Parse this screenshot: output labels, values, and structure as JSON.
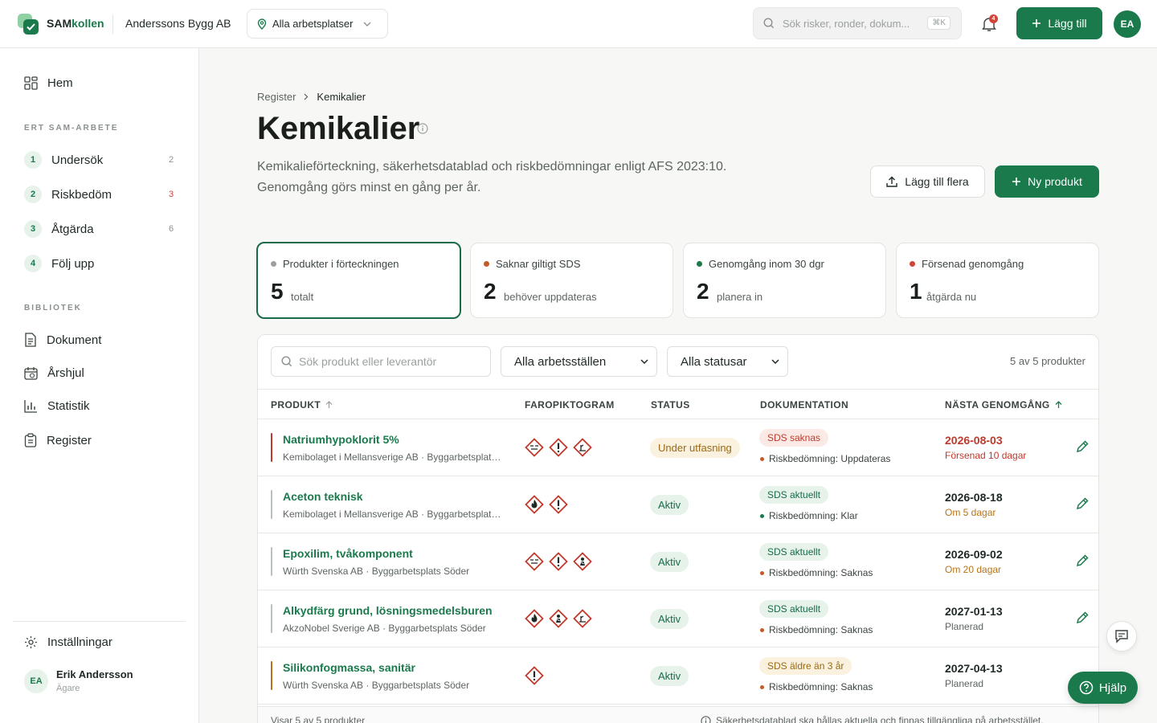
{
  "app": {
    "brand_a": "SAM",
    "brand_b": "kollen",
    "company": "Anderssons Bygg AB",
    "site_select": "Alla arbetsplatser",
    "search_placeholder": "Sök risker, ronder, dokum...",
    "search_shortcut": "⌘K",
    "notifications": "4",
    "add_label": "Lägg till",
    "user_initials": "EA"
  },
  "sidebar": {
    "home": "Hem",
    "section_sam": "ERT SAM-ARBETE",
    "steps": [
      {
        "num": "1",
        "label": "Undersök",
        "count": "2"
      },
      {
        "num": "2",
        "label": "Riskbedöm",
        "count": "3"
      },
      {
        "num": "3",
        "label": "Åtgärda",
        "count": "6"
      },
      {
        "num": "4",
        "label": "Följ upp",
        "count": ""
      }
    ],
    "section_lib": "BIBLIOTEK",
    "library": [
      {
        "label": "Dokument",
        "icon": "document-icon"
      },
      {
        "label": "Årshjul",
        "icon": "calendar-icon"
      },
      {
        "label": "Statistik",
        "icon": "bar-chart-icon"
      },
      {
        "label": "Register",
        "icon": "clipboard-icon"
      }
    ],
    "settings": "Inställningar",
    "user_name": "Erik Andersson",
    "user_role": "Ägare",
    "user_initials": "EA"
  },
  "page": {
    "crumb_parent": "Register",
    "crumb_current": "Kemikalier",
    "title": "Kemikalier",
    "desc1": "Kemikalieförteckning, säkerhetsdatablad och riskbedömningar enligt AFS 2023:10.",
    "desc2": "Genomgång görs minst en gång per år.",
    "btn_bulk": "Lägg till flera",
    "btn_new": "Ny produkt"
  },
  "stats": [
    {
      "label": "Produkter i förteckningen",
      "num": "5",
      "sub": "totalt",
      "color": "#9aa19c"
    },
    {
      "label": "Saknar giltigt SDS",
      "num": "2",
      "sub": "behöver uppdateras",
      "color": "#c25a2a"
    },
    {
      "label": "Genomgång inom 30 dgr",
      "num": "2",
      "sub": "planera in",
      "color": "#1a7a4c"
    },
    {
      "label": "Försenad genomgång",
      "num": "1",
      "sub": "åtgärda nu",
      "color": "#d0443a"
    }
  ],
  "filters": {
    "search_placeholder": "Sök produkt eller leverantör",
    "site": "Alla arbetsställen",
    "status": "Alla statusar",
    "count": "5 av 5 produkter"
  },
  "table": {
    "headers": {
      "product": "PRODUKT",
      "pictograms": "FAROPIKTOGRAM",
      "status": "STATUS",
      "docs": "DOKUMENTATION",
      "next": "NÄSTA GENOMGÅNG"
    },
    "rows": [
      {
        "name": "Natriumhypoklorit 5%",
        "sub": "Kemibolaget i Mellansverige AB · Byggarbetsplats Söder",
        "status": "Under utfasning",
        "sds": "SDS saknas",
        "risk": "Riskbedömning: Uppdateras",
        "date": "2026-08-03",
        "when": "Försenad 10 dagar"
      },
      {
        "name": "Aceton teknisk",
        "sub": "Kemibolaget i Mellansverige AB · Byggarbetsplats Söder",
        "status": "Aktiv",
        "sds": "SDS aktuellt",
        "risk": "Riskbedömning: Klar",
        "date": "2026-08-18",
        "when": "Om 5 dagar"
      },
      {
        "name": "Epoxilim, tvåkomponent",
        "sub": "Würth Svenska AB · Byggarbetsplats Söder",
        "status": "Aktiv",
        "sds": "SDS aktuellt",
        "risk": "Riskbedömning: Saknas",
        "date": "2026-09-02",
        "when": "Om 20 dagar"
      },
      {
        "name": "Alkydfärg grund, lösningsmedelsburen",
        "sub": "AkzoNobel Sverige AB · Byggarbetsplats Söder",
        "status": "Aktiv",
        "sds": "SDS aktuellt",
        "risk": "Riskbedömning: Saknas",
        "date": "2027-01-13",
        "when": "Planerad"
      },
      {
        "name": "Silikonfogmassa, sanitär",
        "sub": "Würth Svenska AB · Byggarbetsplats Söder",
        "status": "Aktiv",
        "sds": "SDS äldre än 3 år",
        "risk": "Riskbedömning: Saknas",
        "date": "2027-04-13",
        "when": "Planerad"
      }
    ],
    "footer_left": "Visar 5 av 5 produkter",
    "footer_right": "Säkerhetsdatablad ska hållas aktuella och finnas tillgängliga på arbetsstället."
  },
  "help": "Hjälp"
}
